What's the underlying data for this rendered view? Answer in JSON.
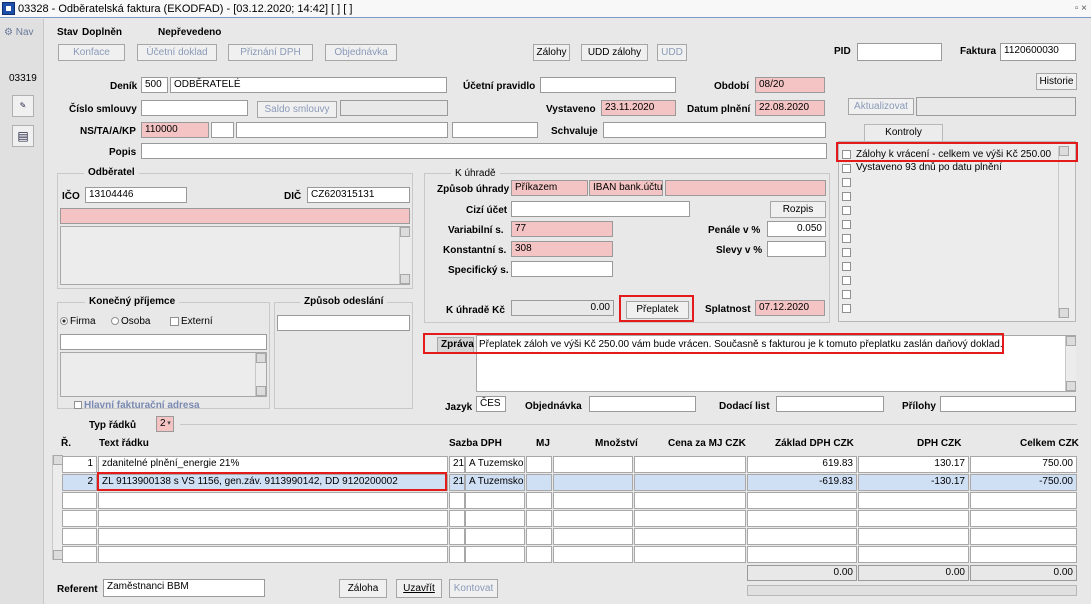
{
  "window": {
    "title": "03328 - Odběratelská faktura (EKODFAD) - [03.12.2020; 14:42] [ ] [ ]",
    "controls": "▫ ×"
  },
  "leftbar": {
    "nav": "Nav",
    "code": "03319"
  },
  "stav": {
    "label": "Stav",
    "value1": "Doplněn",
    "value2": "Nepřevedeno"
  },
  "toolbar": {
    "konfigurace": "Konface",
    "ucetni_doklad": "Účetní doklad",
    "priznani_dph": "Přiznání DPH",
    "objednavka": "Objednávka",
    "zalohy": "Zálohy",
    "udd_zalohy": "UDD zálohy",
    "udd": "UDD"
  },
  "pid": {
    "label": "PID",
    "value": ""
  },
  "faktura": {
    "label": "Faktura",
    "value": "1120600030"
  },
  "historie": "Historie",
  "header": {
    "denik_label": "Deník",
    "denik_code": "500",
    "denik_name": "ODBĚRATELÉ",
    "ucetni_pravidlo_label": "Účetní pravidlo",
    "ucetni_pravidlo_value": "",
    "obdobi_label": "Období",
    "obdobi_value": "08/20",
    "cislo_smlouvy_label": "Číslo smlouvy",
    "saldo_smlouvy": "Saldo smlouvy",
    "vystaveno_label": "Vystaveno",
    "vystaveno_value": "23.11.2020",
    "datum_plneni_label": "Datum plnění",
    "datum_plneni_value": "22.08.2020",
    "aktualizovat": "Aktualizovat",
    "ns_label": "NS/TA/A/KP",
    "ns_value": "110000",
    "schvaluje_label": "Schvaluje",
    "popis_label": "Popis"
  },
  "kontroly": {
    "tab": "Kontroly",
    "items": [
      "Zálohy k vrácení - celkem ve výši Kč 250.00",
      "Vystaveno 93 dnů po datu plnění"
    ]
  },
  "odberatel": {
    "title": "Odběratel",
    "ico_label": "IČO",
    "ico_value": "13104446",
    "dic_label": "DIČ",
    "dic_value": "CZ620315131"
  },
  "k_uhrade": {
    "title": "K úhradě",
    "zpusob_label": "Způsob úhrady",
    "zpusob_value": "Příkazem",
    "iban": "IBAN bank.účtu",
    "cizi_label": "Cizí účet",
    "rozpis": "Rozpis",
    "variabilni_label": "Variabilní s.",
    "variabilni_value": "77",
    "penale_label": "Penále v %",
    "penale_value": "0.050",
    "konstantni_label": "Konstantní s.",
    "konstantni_value": "308",
    "slevy_label": "Slevy v %",
    "specificky_label": "Specifický s.",
    "k_uhrade_label": "K úhradě Kč",
    "k_uhrade_value": "0.00",
    "preplatek": "Přeplatek",
    "splatnost_label": "Splatnost",
    "splatnost_value": "07.12.2020"
  },
  "konecny_prijemce": {
    "title": "Konečný příjemce",
    "firma": "Firma",
    "osoba": "Osoba",
    "externi": "Externí",
    "hlavni": "Hlavní fakturační adresa"
  },
  "zpusob_odeslani": {
    "title": "Způsob odeslání"
  },
  "zprava": {
    "label": "Zpráva",
    "value": "Přeplatek záloh ve výši Kč 250.00 vám bude vrácen. Současně s fakturou je k tomuto přeplatku zaslán daňový doklad."
  },
  "jazyk": {
    "label": "Jazyk",
    "value": "ČES"
  },
  "objednavka2": {
    "label": "Objednávka"
  },
  "dodaci_list": {
    "label": "Dodací list"
  },
  "prilohy": {
    "label": "Přílohy"
  },
  "typ_radku": {
    "label": "Typ řádků",
    "value": "2"
  },
  "table": {
    "headers": {
      "r": "Ř.",
      "text": "Text řádku",
      "sazba": "Sazba DPH",
      "mj": "MJ",
      "mnozstvi": "Množství",
      "cena": "Cena za MJ CZK",
      "zaklad": "Základ DPH CZK",
      "dph": "DPH CZK",
      "celkem": "Celkem CZK"
    },
    "rows": [
      {
        "n": "1",
        "text": "zdanitelné plnění_energie 21%",
        "sazba1": "21",
        "sazba2": "A  Tuzemsko",
        "zaklad": "619.83",
        "dph": "130.17",
        "celkem": "750.00"
      },
      {
        "n": "2",
        "text": "ZL 9113900138 s VS 1156, gen.záv. 9113990142, DD 9120200002",
        "sazba1": "21",
        "sazba2": "A  Tuzemsko",
        "zaklad": "-619.83",
        "dph": "-130.17",
        "celkem": "-750.00"
      }
    ],
    "totals": {
      "zaklad": "0.00",
      "dph": "0.00",
      "celkem": "0.00"
    }
  },
  "footer": {
    "referent_label": "Referent",
    "referent_value": "Zaměstnanci BBM",
    "zaloha": "Záloha",
    "uzavrit": "Uzavřít",
    "kontovat": "Kontovat"
  }
}
